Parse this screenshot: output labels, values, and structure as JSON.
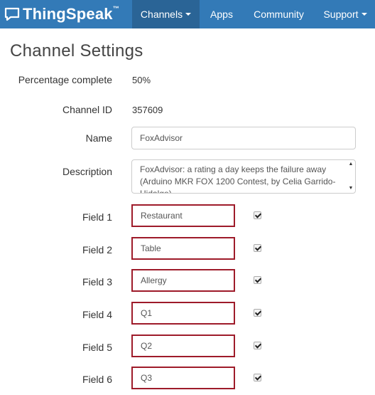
{
  "navbar": {
    "brand": "ThingSpeak",
    "brand_tm": "™",
    "items": [
      {
        "label": "Channels",
        "active": true,
        "dropdown": true
      },
      {
        "label": "Apps",
        "active": false,
        "dropdown": false
      },
      {
        "label": "Community",
        "active": false,
        "dropdown": false
      },
      {
        "label": "Support",
        "active": false,
        "dropdown": true
      }
    ]
  },
  "page": {
    "title": "Channel Settings"
  },
  "settings": {
    "percentage": {
      "label": "Percentage complete",
      "value": "50%"
    },
    "channel_id": {
      "label": "Channel ID",
      "value": "357609"
    },
    "name": {
      "label": "Name",
      "value": "FoxAdvisor"
    },
    "description": {
      "label": "Description",
      "value": "FoxAdvisor: a rating a day keeps the failure away (Arduino MKR FOX 1200 Contest, by Celia Garrido-Hidalgo)"
    },
    "fields": [
      {
        "label": "Field 1",
        "value": "Restaurant",
        "checked": true
      },
      {
        "label": "Field 2",
        "value": "Table",
        "checked": true
      },
      {
        "label": "Field 3",
        "value": "Allergy",
        "checked": true
      },
      {
        "label": "Field 4",
        "value": "Q1",
        "checked": true
      },
      {
        "label": "Field 5",
        "value": "Q2",
        "checked": true
      },
      {
        "label": "Field 6",
        "value": "Q3",
        "checked": true
      }
    ]
  },
  "colors": {
    "navbar": "#337ab7",
    "navbar_active": "#2a6496",
    "field_highlight": "#9e1b2a"
  }
}
